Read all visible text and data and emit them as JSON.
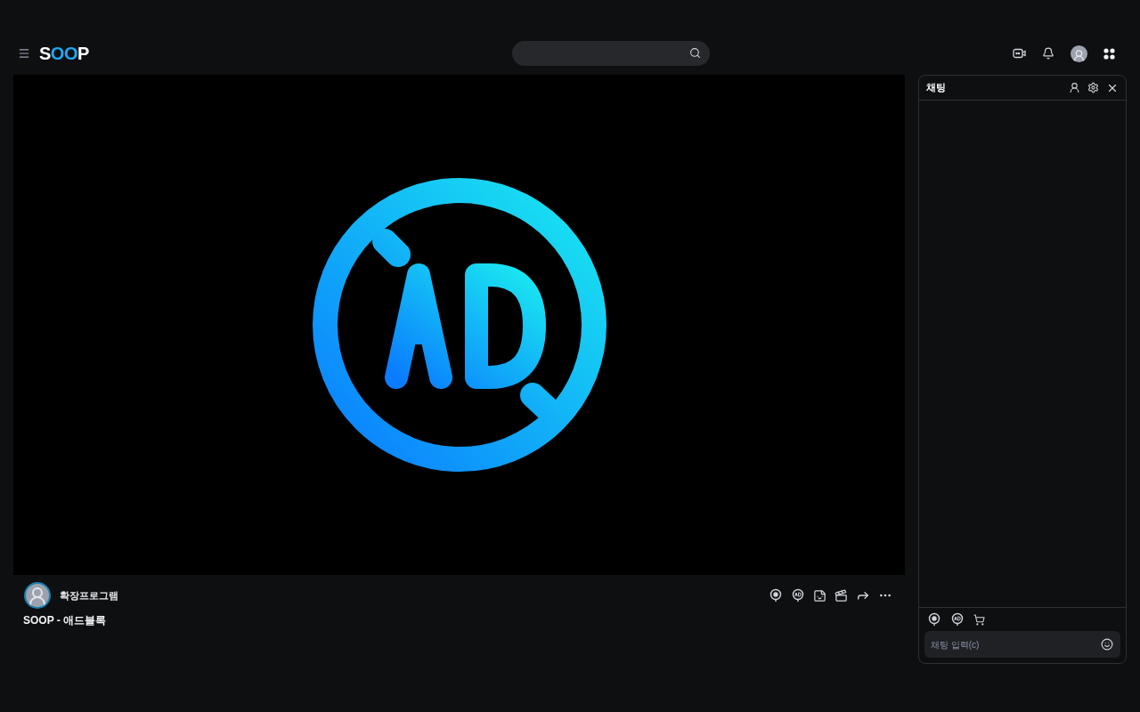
{
  "header": {
    "logo": "SOOP"
  },
  "channel": {
    "name": "확장프로그램",
    "title": "SOOP - 애드블록"
  },
  "chat": {
    "title": "채팅",
    "input": {
      "placeholder": "채팅 입력(c)"
    }
  }
}
